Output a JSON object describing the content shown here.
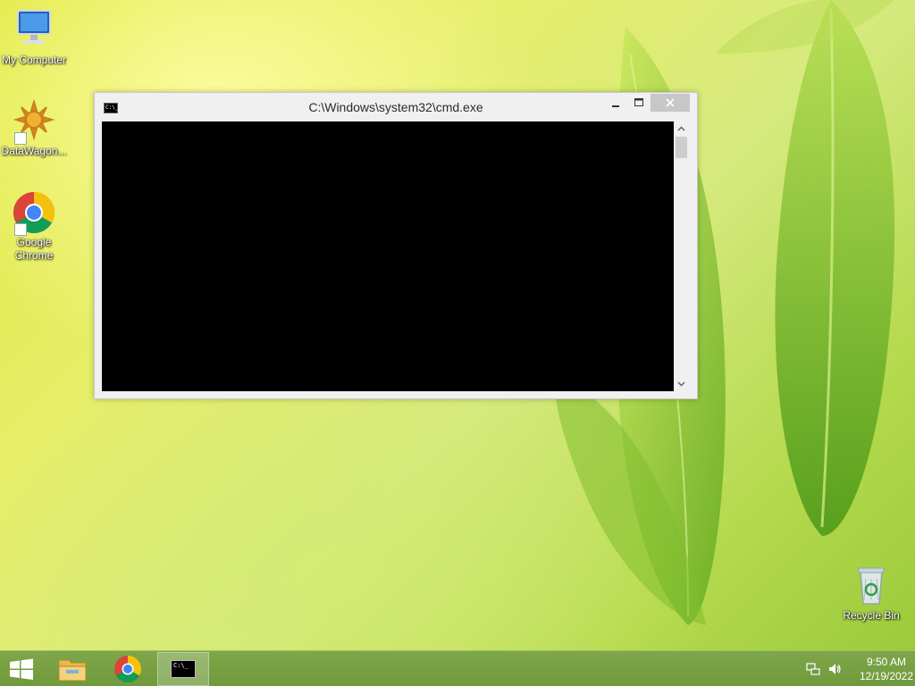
{
  "desktop": {
    "icons": [
      {
        "label": "My Computer"
      },
      {
        "label": "DataWagon..."
      },
      {
        "label": "Google\nChrome"
      }
    ],
    "recycle_bin": {
      "label": "Recycle Bin"
    }
  },
  "window": {
    "title": "C:\\Windows\\system32\\cmd.exe",
    "icon_text": "C:\\_",
    "console_text": ""
  },
  "taskbar": {
    "cmd_icon_text": "C:\\_",
    "clock": {
      "time": "9:50 AM",
      "date": "12/19/2022"
    }
  },
  "colors": {
    "console_bg": "#000000",
    "taskbar": "#7fa64a",
    "window_frame": "#f0f0f0",
    "close_button": "#c7c7c7"
  },
  "icons": {
    "my_computer": "monitor-icon",
    "datawagon": "sun-logo-icon",
    "chrome": "chrome-icon",
    "recycle_bin": "recycle-bin-icon",
    "start": "windows-logo-icon",
    "explorer": "folder-icon",
    "network": "network-icon",
    "volume": "speaker-icon"
  }
}
